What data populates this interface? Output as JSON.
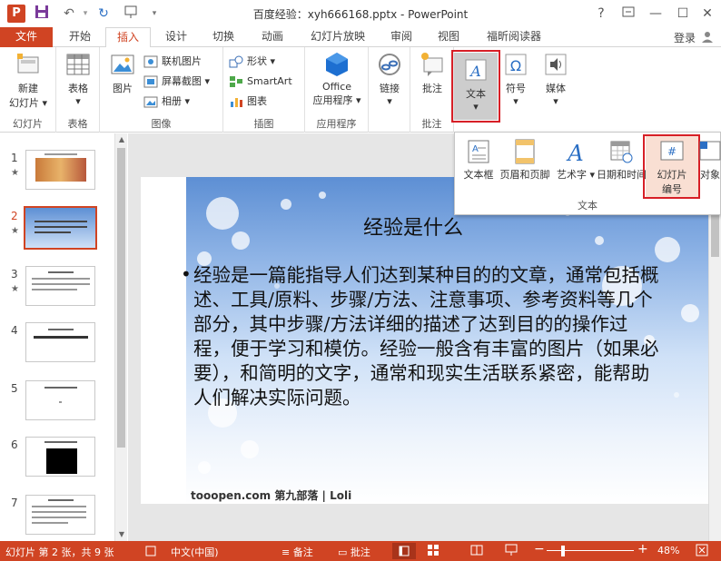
{
  "window": {
    "title": "百度经验：xyh666168.pptx - PowerPoint",
    "app_icon": "P",
    "controls": [
      "?",
      "restore-ribbon",
      "minimize",
      "maximize",
      "close"
    ]
  },
  "tabs": [
    {
      "label": "文件"
    },
    {
      "label": "开始"
    },
    {
      "label": "插入"
    },
    {
      "label": "设计"
    },
    {
      "label": "切换"
    },
    {
      "label": "动画"
    },
    {
      "label": "幻灯片放映"
    },
    {
      "label": "审阅"
    },
    {
      "label": "视图"
    },
    {
      "label": "福昕阅读器"
    }
  ],
  "active_tab": "插入",
  "login": "登录",
  "ribbon": {
    "groups": {
      "slides": "幻灯片",
      "tables": "表格",
      "images": "图像",
      "illustrations": "插图",
      "apps": "应用程序",
      "comments": "批注"
    },
    "buttons": {
      "new_slide": "新建",
      "new_slide_2": "幻灯片",
      "table": "表格",
      "picture": "图片",
      "online_picture": "联机图片",
      "screenshot": "屏幕截图",
      "album": "相册",
      "shapes": "形状",
      "smartart": "SmartArt",
      "chart": "图表",
      "office_apps_1": "Office",
      "office_apps_2": "应用程序",
      "link": "链接",
      "comment": "批注",
      "text": "文本",
      "symbol": "符号",
      "media": "媒体"
    }
  },
  "dropdown": {
    "group_label": "文本",
    "items": [
      {
        "label": "文本框"
      },
      {
        "label": "页眉和页脚"
      },
      {
        "label": "艺术字"
      },
      {
        "label": "日期和时间"
      },
      {
        "label_1": "幻灯片",
        "label_2": "编号"
      },
      {
        "label": "对象"
      }
    ]
  },
  "thumbnails": [
    {
      "num": "1",
      "star": "★"
    },
    {
      "num": "2",
      "star": "★"
    },
    {
      "num": "3",
      "star": "★"
    },
    {
      "num": "4",
      "star": ""
    },
    {
      "num": "5",
      "star": ""
    },
    {
      "num": "6",
      "star": ""
    },
    {
      "num": "7",
      "star": ""
    }
  ],
  "selected_slide": "2",
  "slide": {
    "title": "经验是什么",
    "bullet": "•",
    "body": "经验是一篇能指导人们达到某种目的的文章，通常包括概述、工具/原料、步骤/方法、注意事项、参考资料等几个部分，其中步骤/方法详细的描述了达到目的的操作过程，便于学习和模仿。经验一般含有丰富的图片（如果必要），和简明的文字，通常和现实生活联系紧密，能帮助人们解决实际问题。",
    "footer_logo": "tooopen.com 第九部落 | Loli"
  },
  "statusbar": {
    "slide_info": "幻灯片 第 2 张，共 9 张",
    "language": "中文(中国)",
    "notes": "备注",
    "comments": "批注",
    "zoom": "48%"
  },
  "colors": {
    "accent": "#d04423",
    "highlight": "#d71f26"
  }
}
